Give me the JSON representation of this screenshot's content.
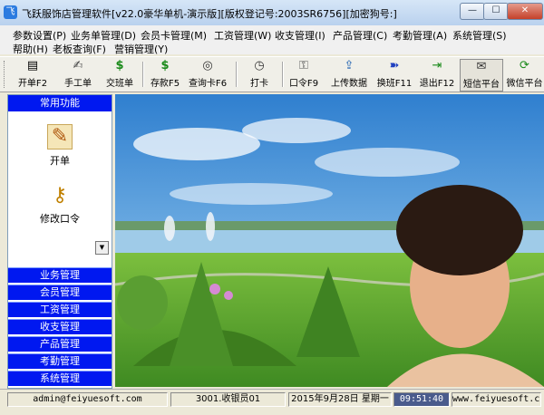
{
  "window": {
    "title": "飞跃服饰店管理软件[v22.0豪华单机-演示版][版权登记号:2003SR6756][加密狗号:]",
    "app_icon": "app-logo-icon",
    "min_glyph": "—",
    "max_glyph": "☐",
    "close_glyph": "✕"
  },
  "menu": {
    "row1": [
      "参数设置(P)",
      "业务单管理(D)",
      "会员卡管理(M)",
      "工资管理(W)",
      "收支管理(I)",
      "产品管理(C)",
      "考勤管理(A)",
      "系统管理(S)"
    ],
    "row2": [
      "帮助(H)",
      "老板查询(F)",
      "营销管理(Y)"
    ]
  },
  "toolbar": [
    {
      "label": "开单F2",
      "icon": "receipt-icon",
      "glyph": "▤"
    },
    {
      "label": "手工单",
      "icon": "handwrite-icon",
      "glyph": "✍"
    },
    {
      "label": "交班单",
      "icon": "money-bag-icon",
      "glyph": "$"
    },
    {
      "label": "存款F5",
      "icon": "deposit-icon",
      "glyph": "$"
    },
    {
      "label": "查询卡F6",
      "icon": "binoculars-icon",
      "glyph": "◎"
    },
    {
      "label": "打卡",
      "icon": "clock-icon",
      "glyph": "◷"
    },
    {
      "label": "口令F9",
      "icon": "key-icon",
      "glyph": "⚿"
    },
    {
      "label": "上传数据",
      "icon": "upload-icon",
      "glyph": "⇪"
    },
    {
      "label": "换班F11",
      "icon": "run-icon",
      "glyph": "➽"
    },
    {
      "label": "退出F12",
      "icon": "exit-icon",
      "glyph": "⇥"
    },
    {
      "label": "短信平台",
      "icon": "sms-icon",
      "glyph": "✉"
    },
    {
      "label": "微信平台",
      "icon": "wechat-icon",
      "glyph": "⟳"
    }
  ],
  "left_panel": {
    "header": "常用功能",
    "tools": [
      {
        "label": "开单",
        "icon": "pencil-note-icon",
        "glyph": "✎"
      },
      {
        "label": "修改口令",
        "icon": "key-person-icon",
        "glyph": "⚷"
      }
    ],
    "scroll_glyph": "▼",
    "categories": [
      "业务管理",
      "会员管理",
      "工资管理",
      "收支管理",
      "产品管理",
      "考勤管理",
      "系统管理"
    ]
  },
  "status": {
    "email": "admin@feiyuesoft.com",
    "user": "3001.收银员01",
    "date": "2015年9月28日  星期一",
    "time": "09:51:40",
    "site": "www.feiyuesoft.com"
  },
  "colors": {
    "accent_blue": "#0018f0",
    "sky": "#3a8fd6",
    "lake": "#8fc4e8",
    "grass": "#4f9a2c"
  }
}
